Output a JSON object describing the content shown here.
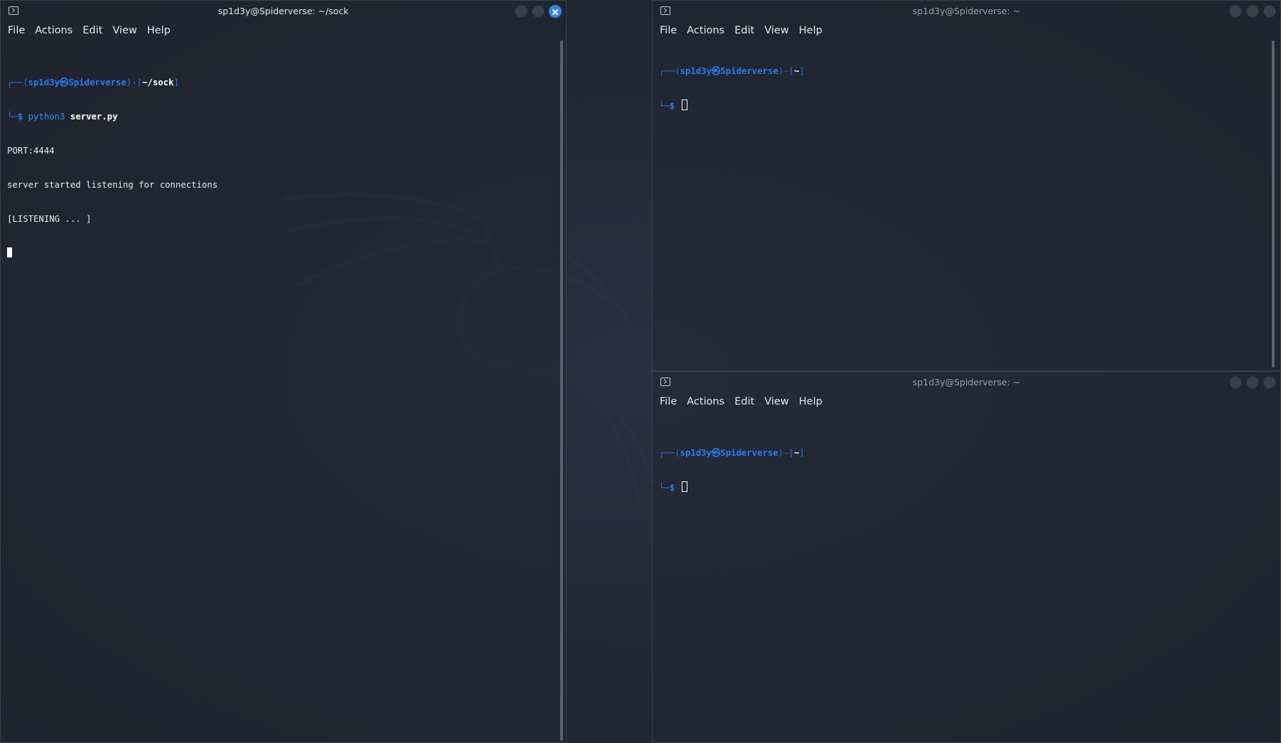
{
  "windows": [
    {
      "title": "sp1d3y@Spiderverse: ~/sock",
      "active": true,
      "menu": [
        "File",
        "Actions",
        "Edit",
        "View",
        "Help"
      ],
      "prompt": {
        "user": "sp1d3y",
        "at": "㉿",
        "host": "Spiderverse",
        "cwd": "~/sock",
        "command": "python3",
        "argument": "server.py"
      },
      "output": [
        "PORT:4444",
        "server started listening for connections",
        "[LISTENING ... ]"
      ]
    },
    {
      "title": "sp1d3y@Spiderverse: ~",
      "active": false,
      "menu": [
        "File",
        "Actions",
        "Edit",
        "View",
        "Help"
      ],
      "prompt": {
        "user": "sp1d3y",
        "at": "㉿",
        "host": "Spiderverse",
        "cwd": "~"
      }
    },
    {
      "title": "sp1d3y@Spiderverse: ~",
      "active": false,
      "menu": [
        "File",
        "Actions",
        "Edit",
        "View",
        "Help"
      ],
      "prompt": {
        "user": "sp1d3y",
        "at": "㉿",
        "host": "Spiderverse",
        "cwd": "~"
      }
    }
  ],
  "icons": {
    "window_icon": "terminal-icon",
    "close": "close-icon",
    "maximize": "maximize-icon",
    "minimize": "minimize-icon",
    "wallpaper": "kali-dragon-logo"
  },
  "colors": {
    "background": "#1f2430",
    "prompt_blue": "#2f7bf0",
    "close_active": "#3584e4",
    "text": "#e8eaee"
  }
}
